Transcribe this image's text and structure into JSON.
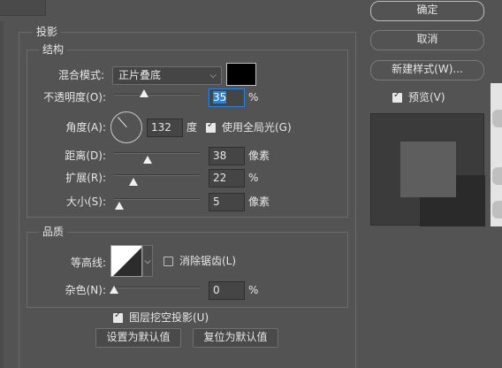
{
  "buttons": {
    "ok": "确定",
    "cancel": "取消",
    "new_style": "新建样式(W)..."
  },
  "preview": {
    "label": "预览(V)",
    "checked": true
  },
  "drop_shadow": {
    "title": "投影",
    "structure": {
      "title": "结构",
      "blend_mode": {
        "label": "混合模式:",
        "value": "正片叠底",
        "color": "#000000"
      },
      "opacity": {
        "label": "不透明度(O):",
        "value": "35",
        "unit": "%"
      },
      "angle": {
        "label": "角度(A):",
        "value": "132",
        "unit": "度",
        "degrees": 132,
        "global_light": {
          "label": "使用全局光(G)",
          "checked": true
        }
      },
      "distance": {
        "label": "距离(D):",
        "value": "38",
        "unit": "像素"
      },
      "spread": {
        "label": "扩展(R):",
        "value": "22",
        "unit": "%"
      },
      "size": {
        "label": "大小(S):",
        "value": "5",
        "unit": "像素"
      }
    },
    "quality": {
      "title": "品质",
      "contour": {
        "label": "等高线:",
        "anti_alias": {
          "label": "消除锯齿(L)",
          "checked": false
        }
      },
      "noise": {
        "label": "杂色(N):",
        "value": "0",
        "unit": "%"
      }
    },
    "knockout": {
      "label": "图层挖空投影(U)",
      "checked": true
    },
    "make_default": "设置为默认值",
    "reset_default": "复位为默认值"
  },
  "colors": {
    "panel_bg": "#535353",
    "focus_blue": "#2a82da"
  }
}
